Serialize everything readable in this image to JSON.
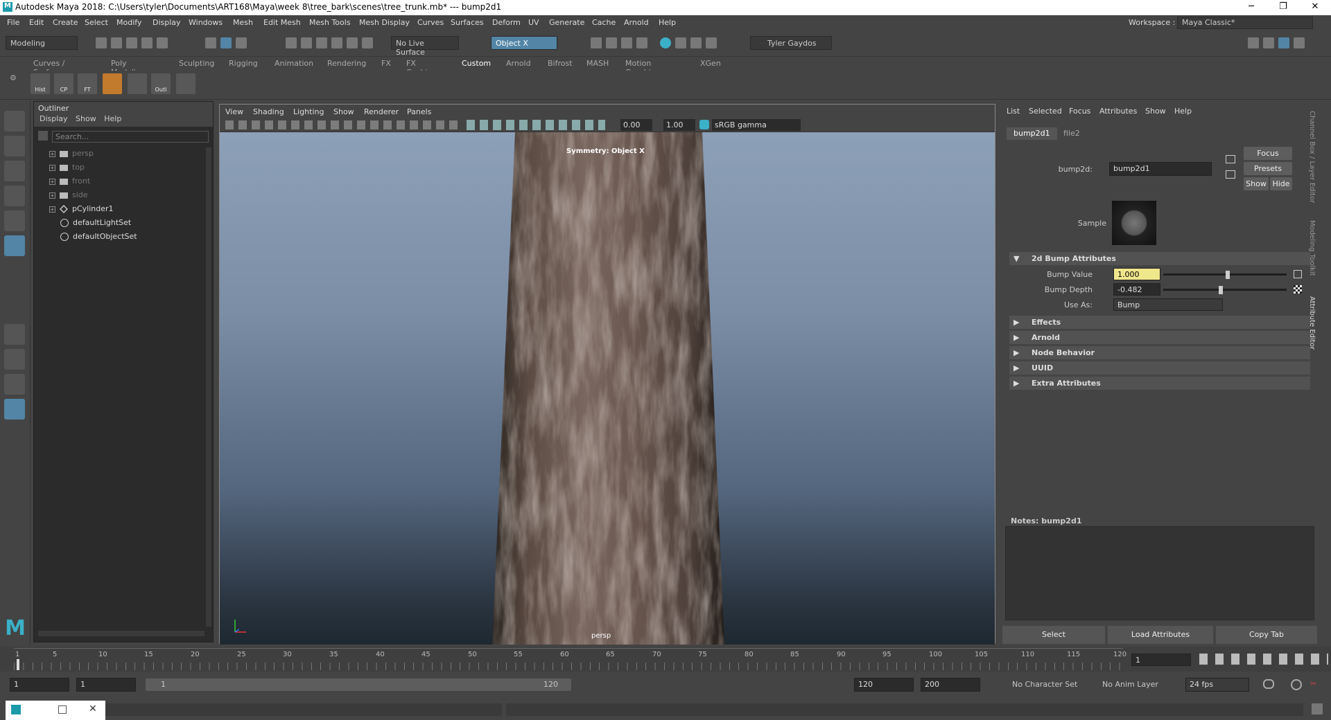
{
  "titlebar": {
    "title": "Autodesk Maya 2018: C:\\Users\\tyler\\Documents\\ART168\\Maya\\week 8\\tree_bark\\scenes\\tree_trunk.mb*   ---   bump2d1",
    "minimize": "─",
    "maximize": "❐",
    "close": "✕"
  },
  "menubar": {
    "items": [
      "File",
      "Edit",
      "Create",
      "Select",
      "Modify",
      "Display",
      "Windows",
      "Mesh",
      "Edit Mesh",
      "Mesh Tools",
      "Mesh Display",
      "Curves",
      "Surfaces",
      "Deform",
      "UV",
      "Generate",
      "Cache",
      "Arnold",
      "Help"
    ],
    "workspace_label": "Workspace :",
    "workspace_value": "Maya Classic*"
  },
  "toolbar": {
    "mode": "Modeling",
    "live_surface": "No Live Surface",
    "symmetry": "Object X",
    "user": "Tyler Gaydos"
  },
  "shelf": {
    "tabs": [
      "Curves / Surfaces",
      "Poly Modeling",
      "Sculpting",
      "Rigging",
      "Animation",
      "Rendering",
      "FX",
      "FX Caching",
      "Custom",
      "Arnold",
      "Bifrost",
      "MASH",
      "Motion Graphics",
      "XGen"
    ],
    "active_tab": "Custom",
    "buttons": [
      "Hist",
      "CP",
      "FT",
      "",
      "",
      "Outl",
      ""
    ]
  },
  "outliner": {
    "title": "Outliner",
    "menu": [
      "Display",
      "Show",
      "Help"
    ],
    "search_placeholder": "Search...",
    "items": [
      {
        "label": "persp",
        "type": "camera"
      },
      {
        "label": "top",
        "type": "camera"
      },
      {
        "label": "front",
        "type": "camera"
      },
      {
        "label": "side",
        "type": "camera"
      },
      {
        "label": "pCylinder1",
        "type": "mesh"
      },
      {
        "label": "defaultLightSet",
        "type": "set"
      },
      {
        "label": "defaultObjectSet",
        "type": "set"
      }
    ]
  },
  "viewport": {
    "menu": [
      "View",
      "Shading",
      "Lighting",
      "Show",
      "Renderer",
      "Panels"
    ],
    "exposure": "0.00",
    "gamma": "1.00",
    "colorspace": "sRGB gamma",
    "hud_symmetry": "Symmetry: Object X",
    "camera_label": "persp"
  },
  "attribute_editor": {
    "menu": [
      "List",
      "Selected",
      "Focus",
      "Attributes",
      "Show",
      "Help"
    ],
    "tabs": [
      "bump2d1",
      "file2"
    ],
    "active_tab": "bump2d1",
    "node_label": "bump2d:",
    "node_value": "bump2d1",
    "focus": "Focus",
    "presets": "Presets",
    "show": "Show",
    "hide": "Hide",
    "sample_label": "Sample",
    "sections": [
      "2d Bump Attributes",
      "Effects",
      "Arnold",
      "Node Behavior",
      "UUID",
      "Extra Attributes"
    ],
    "bump_value_label": "Bump Value",
    "bump_value": "1.000",
    "bump_depth_label": "Bump Depth",
    "bump_depth": "-0.482",
    "use_as_label": "Use As:",
    "use_as": "Bump",
    "notes_label": "Notes:  bump2d1",
    "buttons": [
      "Select",
      "Load Attributes",
      "Copy Tab"
    ],
    "side_tabs": [
      "Channel Box / Layer Editor",
      "Modeling Toolkit",
      "Attribute Editor"
    ]
  },
  "timeline": {
    "ticks": [
      "1",
      "5",
      "10",
      "15",
      "20",
      "25",
      "30",
      "35",
      "40",
      "45",
      "50",
      "55",
      "60",
      "65",
      "70",
      "75",
      "80",
      "85",
      "90",
      "95",
      "100",
      "105",
      "110",
      "115",
      "120"
    ],
    "current_frame": "1"
  },
  "range": {
    "start": "1",
    "start2": "1",
    "range_start": "1",
    "range_end": "120",
    "end": "120",
    "end2": "200",
    "character_set": "No Character Set",
    "anim_layer": "No Anim Layer",
    "fps": "24 fps"
  }
}
